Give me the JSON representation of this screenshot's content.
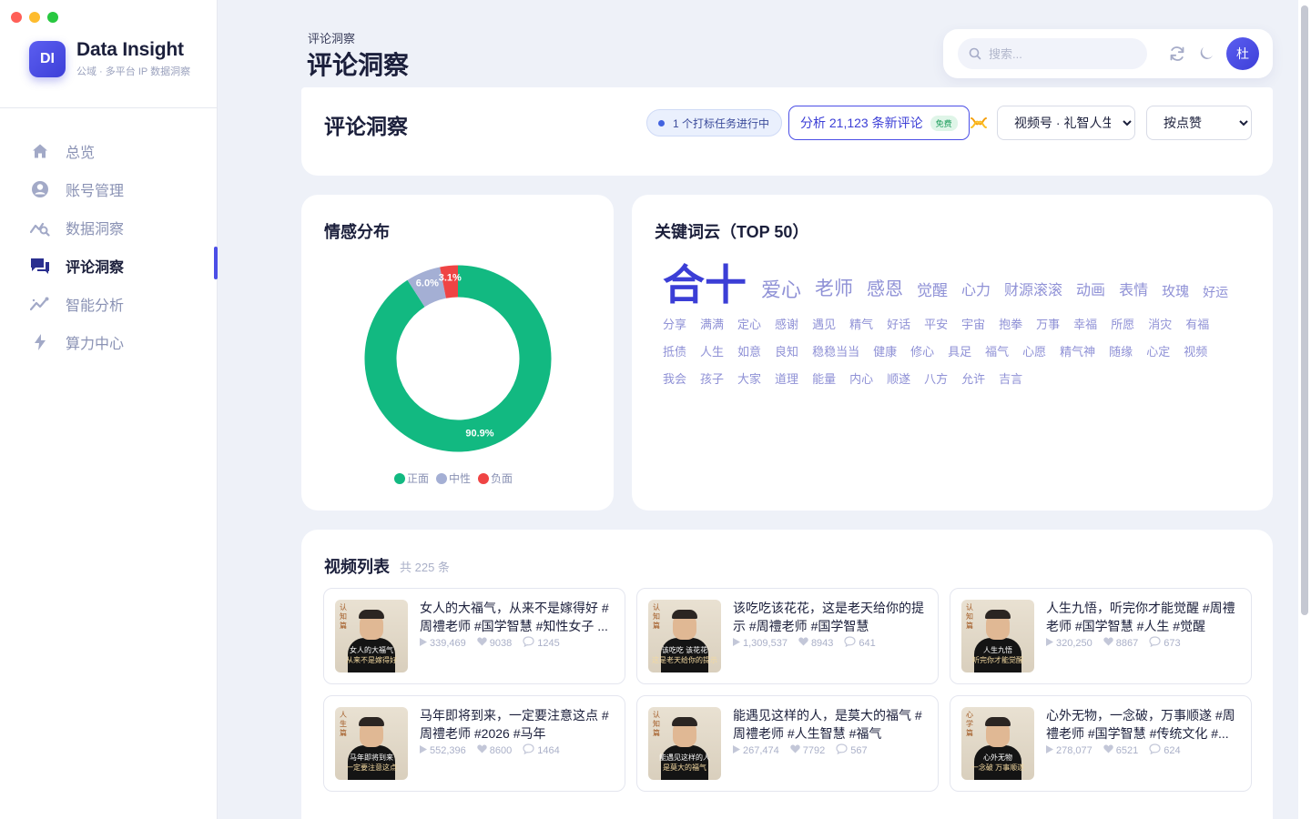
{
  "window": {
    "traffic_colors": [
      "#ff5f57",
      "#febc2e",
      "#28c840"
    ]
  },
  "brand": {
    "logo_text": "DI",
    "title": "Data Insight",
    "subtitle": "公域 · 多平台 IP 数据洞察"
  },
  "sidebar": {
    "items": [
      {
        "label": "总览",
        "icon": "home-icon",
        "active": false
      },
      {
        "label": "账号管理",
        "icon": "user-circle-icon",
        "active": false
      },
      {
        "label": "数据洞察",
        "icon": "chart-magnify-icon",
        "active": false
      },
      {
        "label": "评论洞察",
        "icon": "chat-bubbles-icon",
        "active": true
      },
      {
        "label": "智能分析",
        "icon": "trend-sparkle-icon",
        "active": false
      },
      {
        "label": "算力中心",
        "icon": "lightning-icon",
        "active": false
      }
    ]
  },
  "header": {
    "breadcrumb": "评论洞察",
    "title": "评论洞察",
    "search_placeholder": "搜索...",
    "avatar_text": "杜"
  },
  "toolbar": {
    "title": "评论洞察",
    "task_status": "1 个打标任务进行中",
    "analyze_label": "分析 21,123 条新评论",
    "free_badge": "免费",
    "platform_selected": "视频号 · 礼智人生",
    "sort_selected": "按点赞"
  },
  "sentiment": {
    "title": "情感分布",
    "legend": [
      "正面",
      "中性",
      "负面"
    ],
    "colors": [
      "#12b981",
      "#a4afd4",
      "#ef4444"
    ],
    "values": [
      90.9,
      6.0,
      3.1
    ],
    "value_labels": [
      "90.9%",
      "6.0%",
      "3.1%"
    ]
  },
  "chart_data": {
    "type": "pie",
    "title": "情感分布",
    "categories": [
      "正面",
      "中性",
      "负面"
    ],
    "values": [
      90.9,
      6.0,
      3.1
    ],
    "donut": true,
    "legend": "bottom"
  },
  "keywords": {
    "title": "关键词云（TOP 50）",
    "top": [
      {
        "word": "合十",
        "size": 46,
        "color": "#3b3ed6"
      },
      {
        "word": "爱心",
        "size": 22,
        "color": "#8f91d6"
      },
      {
        "word": "老师",
        "size": 21,
        "color": "#8f91d6"
      },
      {
        "word": "感恩",
        "size": 20,
        "color": "#8f91d6"
      },
      {
        "word": "觉醒",
        "size": 17,
        "color": "#8f91d6"
      },
      {
        "word": "心力",
        "size": 16,
        "color": "#8f91d6"
      },
      {
        "word": "财源滚滚",
        "size": 16,
        "color": "#8f91d6"
      },
      {
        "word": "动画",
        "size": 16,
        "color": "#8f91d6"
      },
      {
        "word": "表情",
        "size": 16,
        "color": "#8f91d6"
      },
      {
        "word": "玫瑰",
        "size": 15,
        "color": "#8f91d6"
      },
      {
        "word": "好运",
        "size": 14,
        "color": "#8f91d6"
      }
    ],
    "rows": [
      [
        "分享",
        "满满",
        "定心",
        "感谢",
        "遇见",
        "精气",
        "好话",
        "平安",
        "宇宙",
        "抱拳",
        "万事",
        "幸福",
        "所愿",
        "消灾",
        "有福"
      ],
      [
        "抵债",
        "人生",
        "如意",
        "良知",
        "稳稳当当",
        "健康",
        "修心",
        "具足",
        "福气",
        "心愿",
        "精气神",
        "随缘",
        "心定",
        "视频"
      ],
      [
        "我会",
        "孩子",
        "大家",
        "道理",
        "能量",
        "内心",
        "顺遂",
        "八方",
        "允许",
        "吉言"
      ]
    ]
  },
  "videos": {
    "title": "视频列表",
    "count": "共 225 条",
    "items": [
      {
        "title": "女人的大福气，从来不是嫁得好 #周禮老师 #国学智慧 #知性女子 ...",
        "plays": "339,469",
        "likes": "9038",
        "comments": "1245",
        "side": "认知篇",
        "cap1": "女人的大福气",
        "cap2": "从来不是嫁得好"
      },
      {
        "title": "该吃吃该花花，这是老天给你的提示 #周禮老师 #国学智慧",
        "plays": "1,309,537",
        "likes": "8943",
        "comments": "641",
        "side": "认知篇",
        "cap1": "该吃吃 该花花",
        "cap2": "这是老天给你的提示"
      },
      {
        "title": "人生九悟，听完你才能觉醒 #周禮老师 #国学智慧 #人生 #觉醒",
        "plays": "320,250",
        "likes": "8867",
        "comments": "673",
        "side": "认知篇",
        "cap1": "人生九悟",
        "cap2": "听完你才能觉醒"
      },
      {
        "title": "马年即将到来，一定要注意这点 #周禮老师 #2026 #马年",
        "plays": "552,396",
        "likes": "8600",
        "comments": "1464",
        "side": "人生篇",
        "cap1": "马年即将到来",
        "cap2": "一定要注意这点"
      },
      {
        "title": "能遇见这样的人，是莫大的福气 #周禮老师 #人生智慧 #福气",
        "plays": "267,474",
        "likes": "7792",
        "comments": "567",
        "side": "认知篇",
        "cap1": "能遇见这样的人",
        "cap2": "是莫大的福气"
      },
      {
        "title": "心外无物，一念破，万事顺遂 #周禮老师 #国学智慧 #传统文化 #...",
        "plays": "278,077",
        "likes": "6521",
        "comments": "624",
        "side": "心学篇",
        "cap1": "心外无物",
        "cap2": "一念破 万事顺遂"
      }
    ]
  }
}
